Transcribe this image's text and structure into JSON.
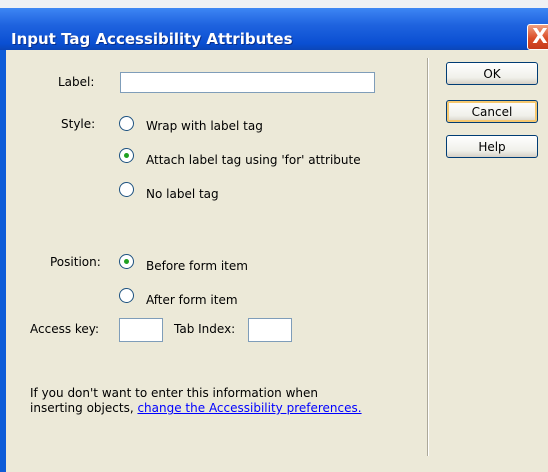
{
  "window": {
    "title": "Input Tag Accessibility Attributes",
    "close_glyph": "X"
  },
  "form": {
    "label_caption": "Label:",
    "label_value": "",
    "style_caption": "Style:",
    "style_options": [
      {
        "label": "Wrap with label tag",
        "checked": false
      },
      {
        "label": "Attach label tag using 'for' attribute",
        "checked": true
      },
      {
        "label": "No label tag",
        "checked": false
      }
    ],
    "position_caption": "Position:",
    "position_options": [
      {
        "label": "Before form item",
        "checked": true
      },
      {
        "label": "After form item",
        "checked": false
      }
    ],
    "access_key_caption": "Access key:",
    "access_key_value": "",
    "tab_index_caption": "Tab Index:",
    "tab_index_value": ""
  },
  "buttons": {
    "ok": "OK",
    "cancel": "Cancel",
    "help": "Help"
  },
  "footer": {
    "line1": "If you don't want to enter this information when",
    "line2_prefix": "inserting objects, ",
    "link": "change the Accessibility preferences."
  },
  "colors": {
    "titlebar": "#0a4fd2",
    "dialog_bg": "#ece9d8",
    "link": "#0000ff",
    "radio_dot": "#21a121",
    "close_button": "#db4d28"
  }
}
